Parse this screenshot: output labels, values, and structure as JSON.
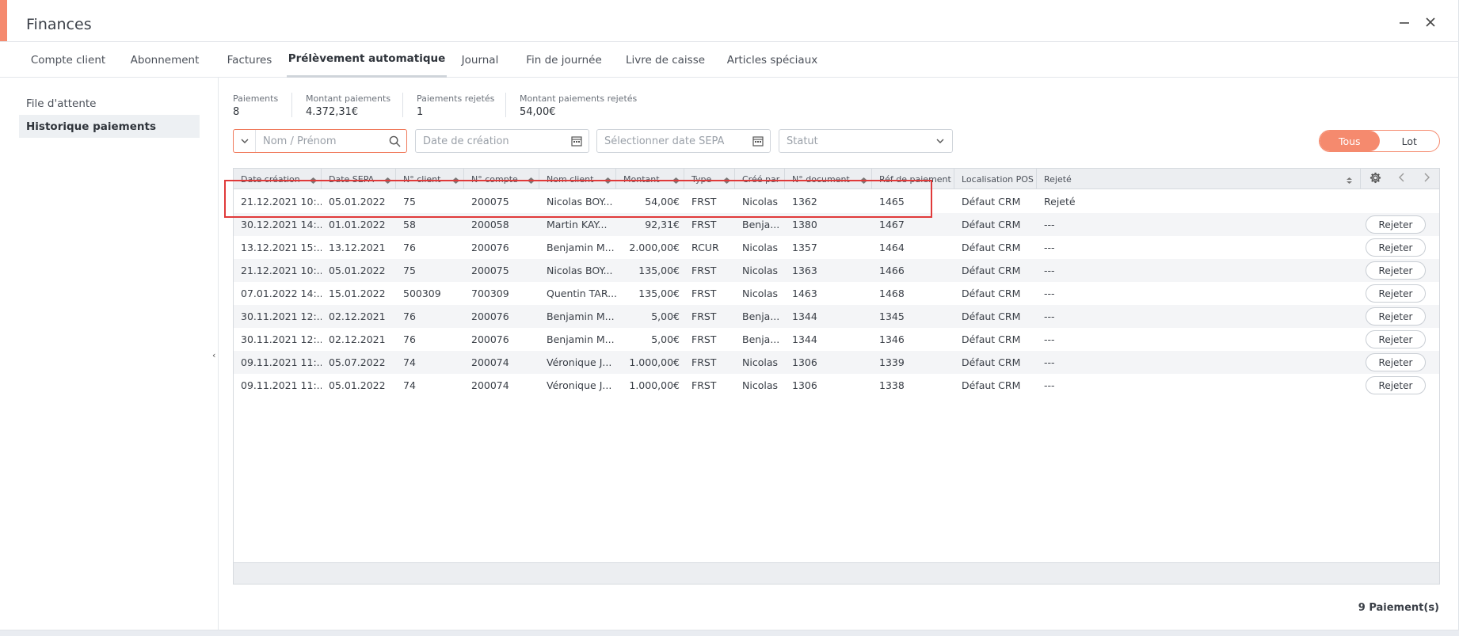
{
  "window": {
    "title": "Finances",
    "accent_color": "#f58a6e",
    "minimize_icon": "minimize-icon",
    "close_icon": "close-icon"
  },
  "tabs": [
    {
      "label": "Compte client",
      "active": false
    },
    {
      "label": "Abonnement",
      "active": false
    },
    {
      "label": "Factures",
      "active": false
    },
    {
      "label": "Prélèvement automatique",
      "active": true
    },
    {
      "label": "Journal",
      "active": false
    },
    {
      "label": "Fin de journée",
      "active": false
    },
    {
      "label": "Livre de caisse",
      "active": false
    },
    {
      "label": "Articles spéciaux",
      "active": false
    }
  ],
  "sidebar": {
    "items": [
      {
        "label": "File d'attente",
        "active": false
      },
      {
        "label": "Historique paiements",
        "active": true
      }
    ]
  },
  "stats": [
    {
      "label": "Paiements",
      "value": "8"
    },
    {
      "label": "Montant paiements",
      "value": "4.372,31€"
    },
    {
      "label": "Paiements rejetés",
      "value": "1"
    },
    {
      "label": "Montant paiements rejetés",
      "value": "54,00€"
    }
  ],
  "filters": {
    "name_placeholder": "Nom / Prénom",
    "creation_date_placeholder": "Date de création",
    "sepa_date_placeholder": "Sélectionner date SEPA",
    "status_placeholder": "Statut"
  },
  "toggle": {
    "all_label": "Tous",
    "batch_label": "Lot",
    "selected": "Tous"
  },
  "table": {
    "columns": [
      "Date création",
      "Date SEPA",
      "N° client",
      "N° compte",
      "Nom client",
      "Montant",
      "Type",
      "Créé par",
      "N° document",
      "Réf de paiement",
      "Localisation POS",
      "Rejeté"
    ],
    "reject_label": "Rejeter",
    "rows": [
      [
        "21.12.2021 10:...",
        "05.01.2022",
        "75",
        "200075",
        "Nicolas BOY...",
        "54,00€",
        "FRST",
        "Nicolas",
        "1362",
        "1465",
        "Défaut CRM",
        "Rejeté"
      ],
      [
        "30.12.2021 14:...",
        "01.01.2022",
        "58",
        "200058",
        "Martin KAY...",
        "92,31€",
        "FRST",
        "Benja...",
        "1380",
        "1467",
        "Défaut CRM",
        "---"
      ],
      [
        "13.12.2021 15:...",
        "13.12.2021",
        "76",
        "200076",
        "Benjamin M...",
        "2.000,00€",
        "RCUR",
        "Nicolas",
        "1357",
        "1464",
        "Défaut CRM",
        "---"
      ],
      [
        "21.12.2021 10:...",
        "05.01.2022",
        "75",
        "200075",
        "Nicolas BOY...",
        "135,00€",
        "FRST",
        "Nicolas",
        "1363",
        "1466",
        "Défaut CRM",
        "---"
      ],
      [
        "07.01.2022 14:...",
        "15.01.2022",
        "500309",
        "700309",
        "Quentin TAR...",
        "135,00€",
        "FRST",
        "Nicolas",
        "1463",
        "1468",
        "Défaut CRM",
        "---"
      ],
      [
        "30.11.2021 12:...",
        "02.12.2021",
        "76",
        "200076",
        "Benjamin M...",
        "5,00€",
        "FRST",
        "Benja...",
        "1344",
        "1345",
        "Défaut CRM",
        "---"
      ],
      [
        "30.11.2021 12:...",
        "02.12.2021",
        "76",
        "200076",
        "Benjamin M...",
        "5,00€",
        "FRST",
        "Benja...",
        "1344",
        "1346",
        "Défaut CRM",
        "---"
      ],
      [
        "09.11.2021 11:...",
        "05.07.2022",
        "74",
        "200074",
        "Véronique J...",
        "1.000,00€",
        "FRST",
        "Nicolas",
        "1306",
        "1339",
        "Défaut CRM",
        "---"
      ],
      [
        "09.11.2021 11:...",
        "05.01.2022",
        "74",
        "200074",
        "Véronique J...",
        "1.000,00€",
        "FRST",
        "Nicolas",
        "1306",
        "1338",
        "Défaut CRM",
        "---"
      ]
    ]
  },
  "footer": {
    "count_label": "9 Paiement(s)"
  }
}
